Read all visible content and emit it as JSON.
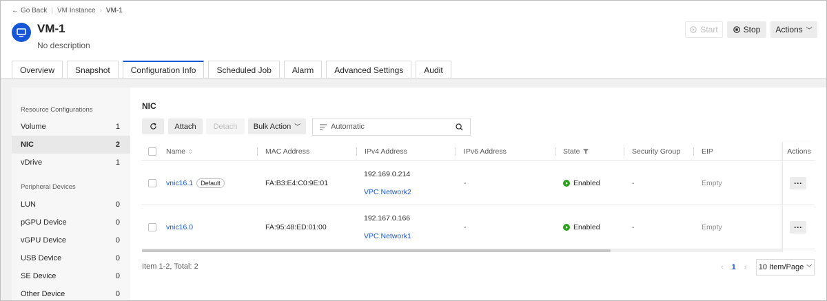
{
  "breadcrumb": {
    "back": "Go Back",
    "parent": "VM Instance",
    "current": "VM-1"
  },
  "header": {
    "title": "VM-1",
    "description": "No description",
    "start_label": "Start",
    "stop_label": "Stop",
    "actions_label": "Actions",
    "accent": "#1557d6"
  },
  "tabs": [
    {
      "label": "Overview"
    },
    {
      "label": "Snapshot"
    },
    {
      "label": "Configuration Info"
    },
    {
      "label": "Scheduled Job"
    },
    {
      "label": "Alarm"
    },
    {
      "label": "Advanced Settings"
    },
    {
      "label": "Audit"
    }
  ],
  "sidebar": {
    "groups": [
      {
        "label": "Resource Configurations",
        "items": [
          {
            "label": "Volume",
            "count": "1"
          },
          {
            "label": "NIC",
            "count": "2"
          },
          {
            "label": "vDrive",
            "count": "1"
          }
        ]
      },
      {
        "label": "Peripheral Devices",
        "items": [
          {
            "label": "LUN",
            "count": "0"
          },
          {
            "label": "pGPU Device",
            "count": "0"
          },
          {
            "label": "vGPU Device",
            "count": "0"
          },
          {
            "label": "USB Device",
            "count": "0"
          },
          {
            "label": "SE Device",
            "count": "0"
          },
          {
            "label": "Other Device",
            "count": "0"
          }
        ]
      }
    ]
  },
  "section": {
    "title": "NIC"
  },
  "toolbar": {
    "attach": "Attach",
    "detach": "Detach",
    "bulk_action": "Bulk Action",
    "search_value": "Automatic"
  },
  "table": {
    "headers": {
      "name": "Name",
      "mac": "MAC Address",
      "ipv4": "IPv4 Address",
      "ipv6": "IPv6 Address",
      "state": "State",
      "sg": "Security Group",
      "eip": "EIP",
      "actions": "Actions"
    },
    "rows": [
      {
        "name": "vnic16.1",
        "badge": "Default",
        "mac": "FA:B3:E4:C0:9E:01",
        "ipv4": "192.169.0.214",
        "network": "VPC Network2",
        "ipv6": "-",
        "state": "Enabled",
        "sg": "-",
        "eip": "Empty",
        "more": "···"
      },
      {
        "name": "vnic16.0",
        "badge": "",
        "mac": "FA:95:48:ED:01:00",
        "ipv4": "192.167.0.166",
        "network": "VPC Network1",
        "ipv6": "-",
        "state": "Enabled",
        "sg": "-",
        "eip": "Empty",
        "more": "···"
      }
    ],
    "status_color": "#2ea121"
  },
  "footer": {
    "total": "Item 1-2, Total: 2",
    "page": "1",
    "page_size": "10 Item/Page"
  }
}
